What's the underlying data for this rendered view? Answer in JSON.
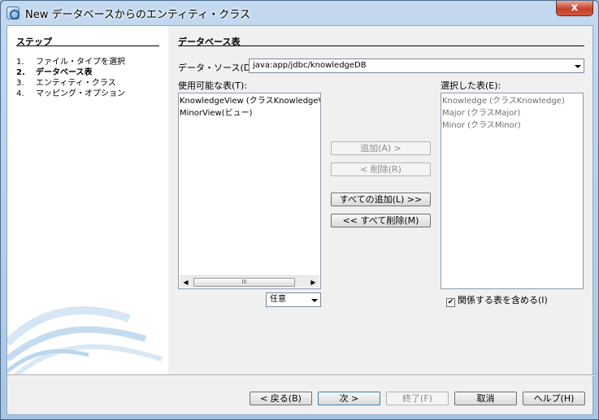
{
  "window": {
    "title": "New データベースからのエンティティ・クラス",
    "close_label": "x"
  },
  "steps": {
    "title": "ステップ",
    "items": [
      {
        "num": "1.",
        "label": "ファイル・タイプを選択"
      },
      {
        "num": "2.",
        "label": "データベース表"
      },
      {
        "num": "3.",
        "label": "エンティティ・クラス"
      },
      {
        "num": "4.",
        "label": "マッピング・オプション"
      }
    ]
  },
  "main": {
    "section_title": "データベース表",
    "datasource": {
      "label": "データ・ソース(D):",
      "value": "java:app/jdbc/knowledgeDB"
    },
    "available": {
      "label": "使用可能な表(T):",
      "items": [
        "KnowledgeView (クラスKnowledgeV",
        "MinorView(ビュー)"
      ],
      "filter": "任意"
    },
    "selected": {
      "label": "選択した表(E):",
      "items": [
        "Knowledge (クラスKnowledge)",
        "Major (クラスMajor)",
        "Minor (クラスMinor)"
      ]
    },
    "buttons": {
      "add": "追加(A) >",
      "remove": "< 削除(R)",
      "add_all": "すべての追加(L) >>",
      "remove_all": "<< すべて削除(M)"
    },
    "include_related": {
      "label": "関係する表を含める(I)",
      "checked": true
    }
  },
  "footer": {
    "back": "< 戻る(B)",
    "next": "次 >",
    "finish": "終了(F)",
    "cancel": "取消",
    "help": "ヘルプ(H)"
  }
}
